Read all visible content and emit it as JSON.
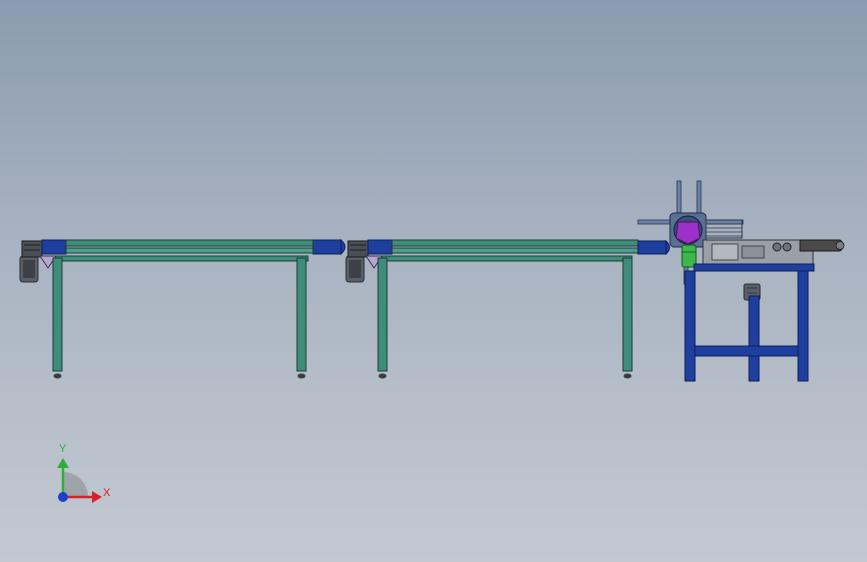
{
  "viewport": {
    "background_top": "#8c9bb0",
    "background_bottom": "#c3c9d1"
  },
  "colors": {
    "frame_blue": "#1f3f9e",
    "rail_teal": "#3e8c7a",
    "rail_edge": "#1d3b34",
    "motor_gray": "#5a5f66",
    "motor_dark": "#2b2e33",
    "hub_purple": "#9b32c8",
    "cylinder_green": "#3cb84a",
    "machine_gray": "#9aa0a8",
    "belt_dark": "#4a4a4a",
    "axis_x": "#d6212b",
    "axis_y": "#2fae3c",
    "axis_origin": "#1f3fc8"
  },
  "scene": {
    "conveyors": [
      "conveyor-1",
      "conveyor-2",
      "conveyor-3"
    ],
    "station": "rotary-transfer-station",
    "stand": "blue-steel-stand"
  },
  "triad": {
    "x_label": "X",
    "y_label": "Y",
    "icons": [
      "x-axis-arrow-icon",
      "y-axis-arrow-icon",
      "origin-dot-icon"
    ]
  }
}
